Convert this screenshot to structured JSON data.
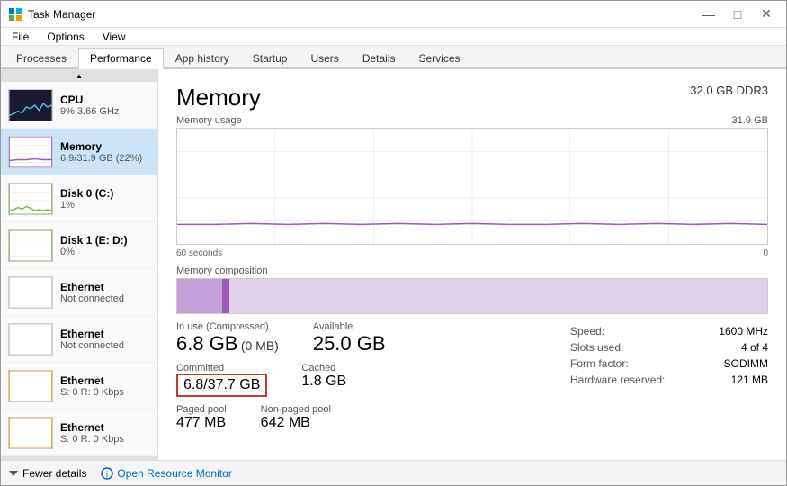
{
  "window": {
    "title": "Task Manager",
    "controls": {
      "minimize": "—",
      "maximize": "□",
      "close": "✕"
    }
  },
  "menu": {
    "items": [
      "File",
      "Options",
      "View"
    ]
  },
  "tabs": [
    {
      "label": "Processes",
      "active": false
    },
    {
      "label": "Performance",
      "active": true
    },
    {
      "label": "App history",
      "active": false
    },
    {
      "label": "Startup",
      "active": false
    },
    {
      "label": "Users",
      "active": false
    },
    {
      "label": "Details",
      "active": false
    },
    {
      "label": "Services",
      "active": false
    }
  ],
  "sidebar": {
    "items": [
      {
        "id": "cpu",
        "name": "CPU",
        "value": "9% 3.66 GHz",
        "active": false
      },
      {
        "id": "memory",
        "name": "Memory",
        "value": "6.9/31.9 GB (22%)",
        "active": true
      },
      {
        "id": "disk0",
        "name": "Disk 0 (C:)",
        "value": "1%",
        "active": false
      },
      {
        "id": "disk1",
        "name": "Disk 1 (E: D:)",
        "value": "0%",
        "active": false
      },
      {
        "id": "eth1",
        "name": "Ethernet",
        "value": "Not connected",
        "active": false
      },
      {
        "id": "eth2",
        "name": "Ethernet",
        "value": "Not connected",
        "active": false
      },
      {
        "id": "eth3",
        "name": "Ethernet",
        "value": "S: 0 R: 0 Kbps",
        "active": false
      },
      {
        "id": "eth4",
        "name": "Ethernet",
        "value": "S: 0 R: 0 Kbps",
        "active": false
      }
    ]
  },
  "main": {
    "title": "Memory",
    "subtitle": "32.0 GB DDR3",
    "chart_label": "Memory usage",
    "chart_max": "31.9 GB",
    "time_left": "60 seconds",
    "time_right": "0",
    "composition_label": "Memory composition",
    "stats": {
      "in_use_label": "In use (Compressed)",
      "in_use_value": "6.8 GB",
      "in_use_sub": "(0 MB)",
      "available_label": "Available",
      "available_value": "25.0 GB",
      "committed_label": "Committed",
      "committed_value": "6.8/37.7 GB",
      "cached_label": "Cached",
      "cached_value": "1.8 GB",
      "paged_label": "Paged pool",
      "paged_value": "477 MB",
      "nonpaged_label": "Non-paged pool",
      "nonpaged_value": "642 MB"
    },
    "right_stats": {
      "speed_label": "Speed:",
      "speed_value": "1600 MHz",
      "slots_label": "Slots used:",
      "slots_value": "4 of 4",
      "form_label": "Form factor:",
      "form_value": "SODIMM",
      "hw_label": "Hardware reserved:",
      "hw_value": "121 MB"
    }
  },
  "footer": {
    "fewer_details": "Fewer details",
    "open_resource_monitor": "Open Resource Monitor"
  }
}
